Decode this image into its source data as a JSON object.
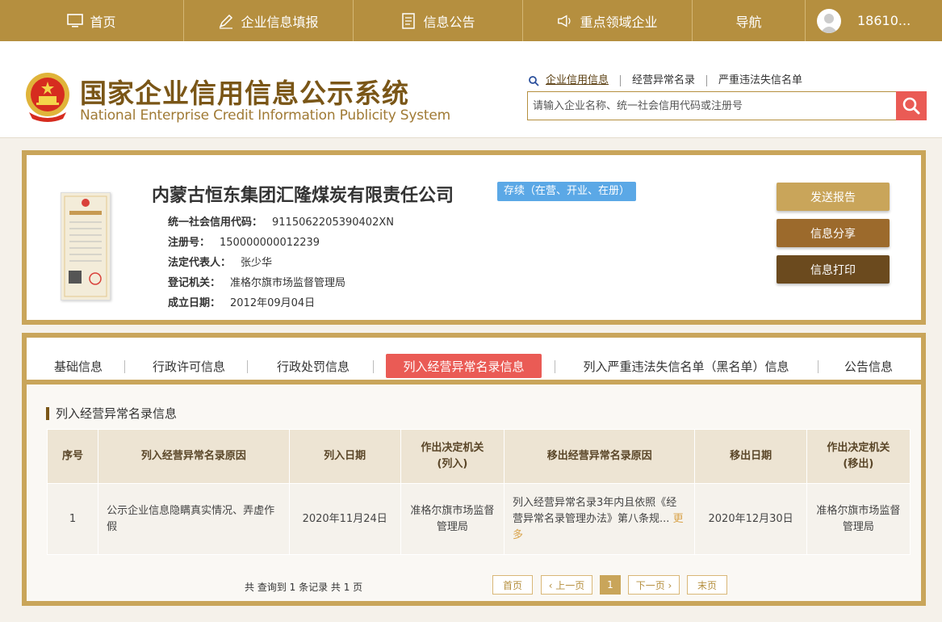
{
  "topnav": {
    "items": [
      {
        "label": "首页",
        "icon": "monitor-icon"
      },
      {
        "label": "企业信息填报",
        "icon": "edit-icon"
      },
      {
        "label": "信息公告",
        "icon": "document-icon"
      },
      {
        "label": "重点领域企业",
        "icon": "megaphone-icon"
      },
      {
        "label": "导航",
        "icon": ""
      }
    ],
    "user": "18610..."
  },
  "header": {
    "title_cn": "国家企业信用信息公示系统",
    "title_en": "National Enterprise Credit Information Publicity System",
    "search_links": [
      "企业信用信息",
      "经营异常名录",
      "严重违法失信名单"
    ],
    "search_placeholder": "请输入企业名称、统一社会信用代码或注册号"
  },
  "company": {
    "name": "内蒙古恒东集团汇隆煤炭有限责任公司",
    "status": "存续（在营、开业、在册）",
    "fields": [
      {
        "label": "统一社会信用代码：",
        "value": "9115062205390402XN"
      },
      {
        "label": "注册号：",
        "value": "150000000012239"
      },
      {
        "label": "法定代表人：",
        "value": "张少华"
      },
      {
        "label": "登记机关：",
        "value": "准格尔旗市场监督管理局"
      },
      {
        "label": "成立日期：",
        "value": "2012年09月04日"
      }
    ],
    "buttons": {
      "send_report": "发送报告",
      "share": "信息分享",
      "print": "信息打印"
    }
  },
  "tabs": [
    "基础信息",
    "行政许可信息",
    "行政处罚信息",
    "列入经营异常名录信息",
    "列入严重违法失信名单（黑名单）信息",
    "公告信息"
  ],
  "section": {
    "title": "列入经营异常名录信息",
    "columns": [
      "序号",
      "列入经营异常名录原因",
      "列入日期",
      "作出决定机关\n(列入)",
      "移出经营异常名录原因",
      "移出日期",
      "作出决定机关\n(移出)"
    ],
    "rows": [
      {
        "no": "1",
        "reason": "公示企业信息隐瞒真实情况、弄虚作假",
        "date_in": "2020年11月24日",
        "org_in": "准格尔旗市场监督管理局",
        "reason_out": "列入经营异常名录3年内且依照《经营异常名录管理办法》第八条规...",
        "more": "更多",
        "date_out": "2020年12月30日",
        "org_out": "准格尔旗市场监督管理局"
      }
    ]
  },
  "pager": {
    "info": "共 查询到 1 条记录 共 1 页",
    "first": "首页",
    "prev": "‹ 上一页",
    "current": "1",
    "next": "下一页 ›",
    "last": "末页"
  },
  "colors": {
    "gold": "#b58f3f",
    "border_gold": "#c9a55a",
    "red": "#ea5b55",
    "status_blue": "#5ba8e6",
    "brown": "#7a5617"
  }
}
